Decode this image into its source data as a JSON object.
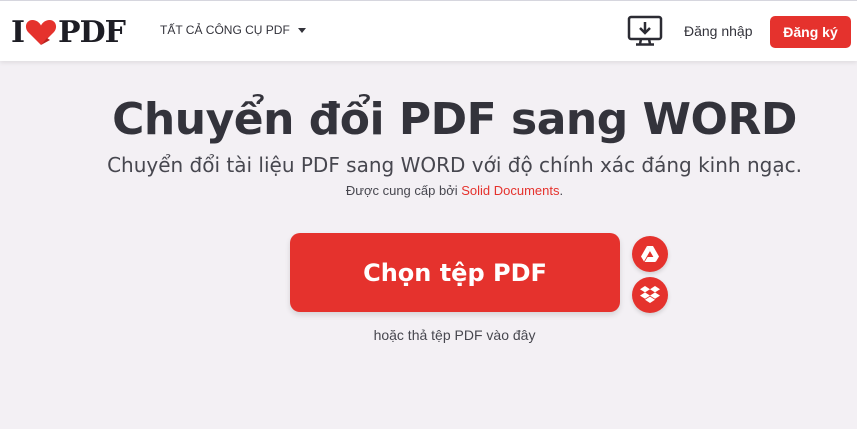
{
  "header": {
    "logo_left": "I",
    "logo_right": "PDF",
    "tools_menu_label": "TẤT CẢ CÔNG CỤ PDF",
    "login_label": "Đăng nhập",
    "signup_label": "Đăng ký"
  },
  "main": {
    "title": "Chuyển đổi PDF sang WORD",
    "subtitle": "Chuyển đổi tài liệu PDF sang WORD với độ chính xác đáng kinh ngạc.",
    "powered_prefix": "Được cung cấp bởi ",
    "powered_link": "Solid Documents",
    "powered_suffix": ".",
    "select_button_label": "Chọn tệp PDF",
    "drop_hint": "hoặc thả tệp PDF vào đây"
  },
  "icons": {
    "logo_heart": "heart-icon",
    "tools_caret": "caret-down-icon",
    "desktop": "desktop-download-icon",
    "google_drive": "google-drive-icon",
    "dropbox": "dropbox-icon"
  },
  "colors": {
    "brand_red": "#e5322d",
    "background": "#f3f0f4",
    "text_dark": "#33333b"
  }
}
